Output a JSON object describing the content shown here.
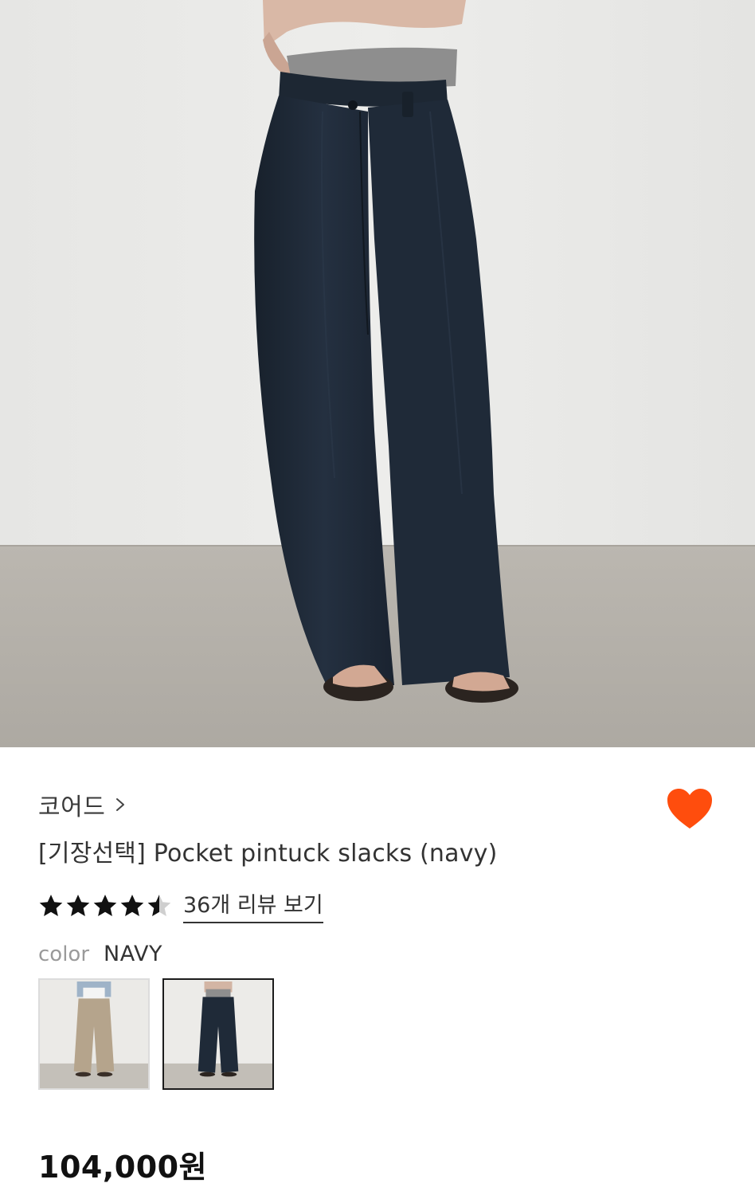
{
  "product": {
    "brand": "코어드",
    "title": "[기장선택] Pocket pintuck slacks (navy)",
    "rating": 4.5,
    "review_link": "36개 리뷰 보기",
    "color_label": "color",
    "color_value": "NAVY",
    "price": "104,000원",
    "liked": true
  },
  "swatches": [
    {
      "name": "beige",
      "selected": false
    },
    {
      "name": "navy",
      "selected": true
    }
  ],
  "colors": {
    "heart": "#ff4d0d",
    "navy_pants": "#1f2a38",
    "wall": "#e9e9e7",
    "floor": "#b7b3ac"
  },
  "icons": {
    "brand_chevron": "chevron-right-icon",
    "like": "heart-icon",
    "rating": "star-icon"
  }
}
